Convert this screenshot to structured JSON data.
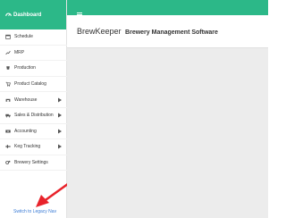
{
  "brand": {
    "label": "Dashboard",
    "icon": "dashboard-icon",
    "color": "#2cb888"
  },
  "sidebar": {
    "items": [
      {
        "label": "Schedule",
        "icon": "calendar-icon",
        "has_submenu": false
      },
      {
        "label": "MRP",
        "icon": "chart-icon",
        "has_submenu": false
      },
      {
        "label": "Production",
        "icon": "flask-icon",
        "has_submenu": false
      },
      {
        "label": "Product Catalog",
        "icon": "cart-icon",
        "has_submenu": false
      },
      {
        "label": "Warehouse",
        "icon": "warehouse-icon",
        "has_submenu": true
      },
      {
        "label": "Sales & Distribution",
        "icon": "truck-icon",
        "has_submenu": true
      },
      {
        "label": "Accounting",
        "icon": "money-icon",
        "has_submenu": true
      },
      {
        "label": "Keg Tracking",
        "icon": "keg-icon",
        "has_submenu": true
      },
      {
        "label": "Brewery Settings",
        "icon": "gears-icon",
        "has_submenu": false
      }
    ],
    "legacy_link": "Switch to Legacy Nav"
  },
  "header": {
    "brand_name": "BrewKeeper",
    "subtitle": "Brewery Management Software"
  },
  "colors": {
    "accent": "#2cb888",
    "link": "#3a7bd5",
    "arrow": "#e8232b",
    "content_bg": "#ececec"
  }
}
